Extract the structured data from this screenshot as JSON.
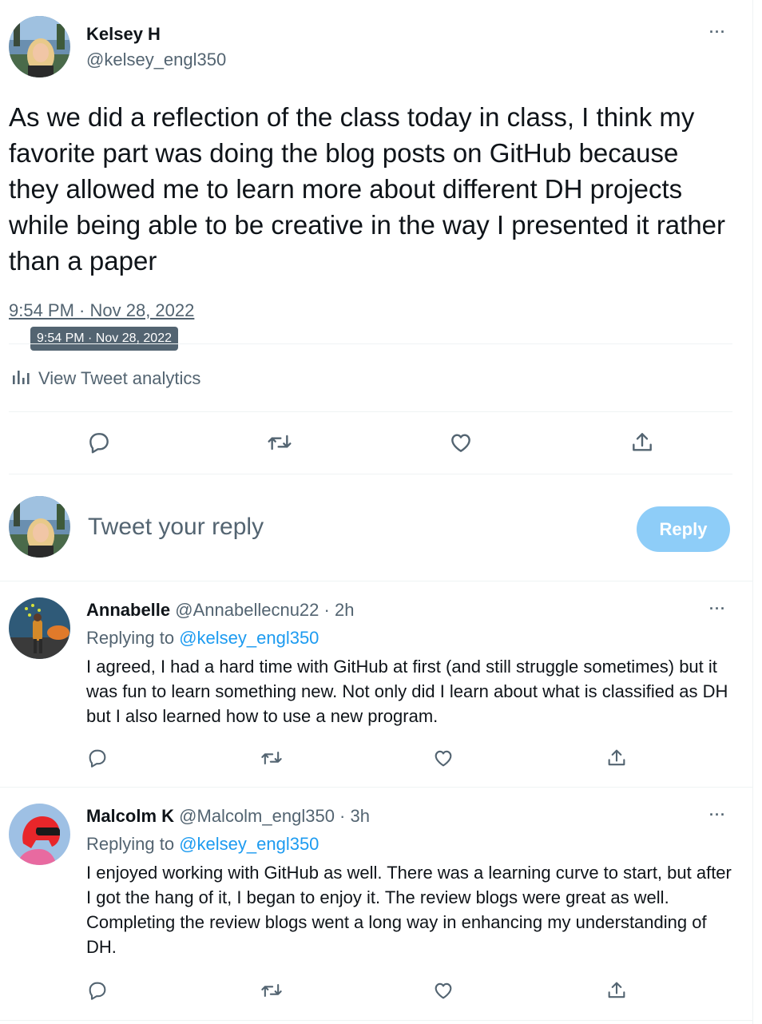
{
  "main_tweet": {
    "author_name": "Kelsey H",
    "author_handle": "@kelsey_engl350",
    "text": "As we did a reflection of the class today in class, I think my favorite part was doing the blog posts on GitHub because they allowed me to learn more about different DH projects while being able to be creative in the way I presented it rather than a paper",
    "timestamp": "9:54 PM · Nov 28, 2022",
    "tooltip": "9:54 PM · Nov 28, 2022",
    "analytics_label": "View Tweet analytics",
    "more": "···"
  },
  "composer": {
    "placeholder": "Tweet your reply",
    "reply_button": "Reply"
  },
  "replies": [
    {
      "name": "Annabelle",
      "handle_time": "@Annabellecnu22 · 2h",
      "replying_prefix": "Replying to ",
      "replying_handle": "@kelsey_engl350",
      "text": "I agreed, I had a hard time with GitHub at first (and still struggle sometimes) but it was fun to learn something new. Not only did I learn about what is classified as DH but I also learned how to use a new program.",
      "more": "···"
    },
    {
      "name": "Malcolm K",
      "handle_time": "@Malcolm_engl350 · 3h",
      "replying_prefix": "Replying to ",
      "replying_handle": "@kelsey_engl350",
      "text": "I enjoyed working with GitHub as well. There was a learning curve to start, but after I got the hang of it, I began to enjoy it. The review blogs were great as well. Completing the review blogs went a long way in enhancing my understanding of DH.",
      "more": "···"
    }
  ],
  "colors": {
    "accent": "#1d9bf0",
    "reply_button_disabled": "#8ecdf8",
    "muted": "#536471"
  },
  "icons": [
    "comment-icon",
    "retweet-icon",
    "like-icon",
    "share-icon",
    "analytics-icon",
    "more-icon"
  ]
}
